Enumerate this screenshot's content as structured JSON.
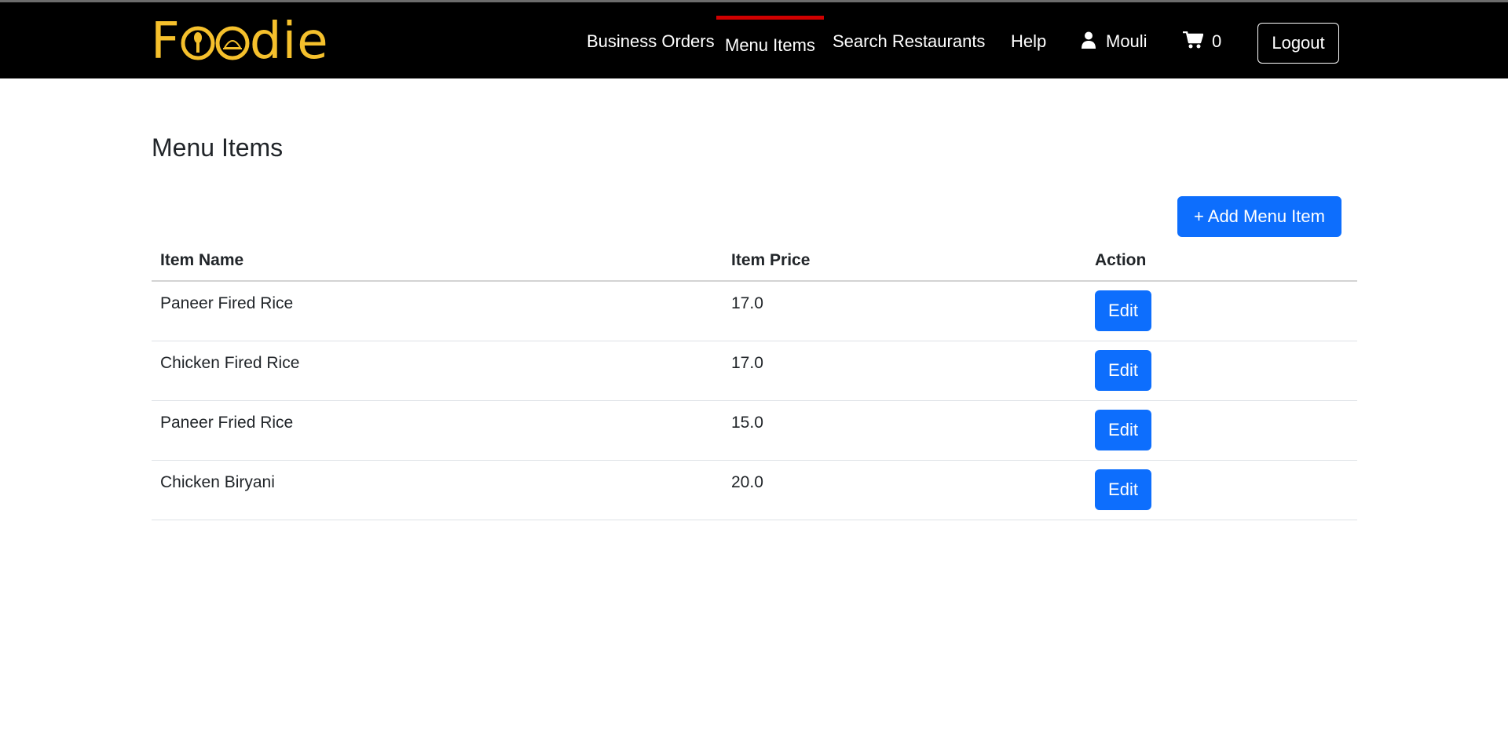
{
  "brand": {
    "logo_text": "Foodie",
    "color": "#f5c02c"
  },
  "nav": {
    "links": [
      {
        "label": "Business Orders"
      },
      {
        "label": "Menu Items",
        "active": true
      },
      {
        "label": "Search Restaurants"
      },
      {
        "label": "Help"
      }
    ],
    "user": {
      "name": "Mouli",
      "icon": "user-icon"
    },
    "cart": {
      "count": "0",
      "icon": "cart-icon"
    },
    "logout_label": "Logout",
    "active_indicator_color": "#d00000"
  },
  "main": {
    "title": "Menu Items",
    "add_button_label": "+ Add Menu Item",
    "table": {
      "headers": [
        "Item Name",
        "Item Price",
        "Action"
      ],
      "rows": [
        {
          "name": "Paneer Fired Rice",
          "price": "17.0",
          "action": "Edit"
        },
        {
          "name": "Chicken Fired Rice",
          "price": "17.0",
          "action": "Edit"
        },
        {
          "name": "Paneer Fried Rice",
          "price": "15.0",
          "action": "Edit"
        },
        {
          "name": "Chicken Biryani",
          "price": "20.0",
          "action": "Edit"
        }
      ]
    }
  },
  "colors": {
    "navbar": "#000000",
    "primary": "#0d6efd",
    "text": "#212529"
  }
}
